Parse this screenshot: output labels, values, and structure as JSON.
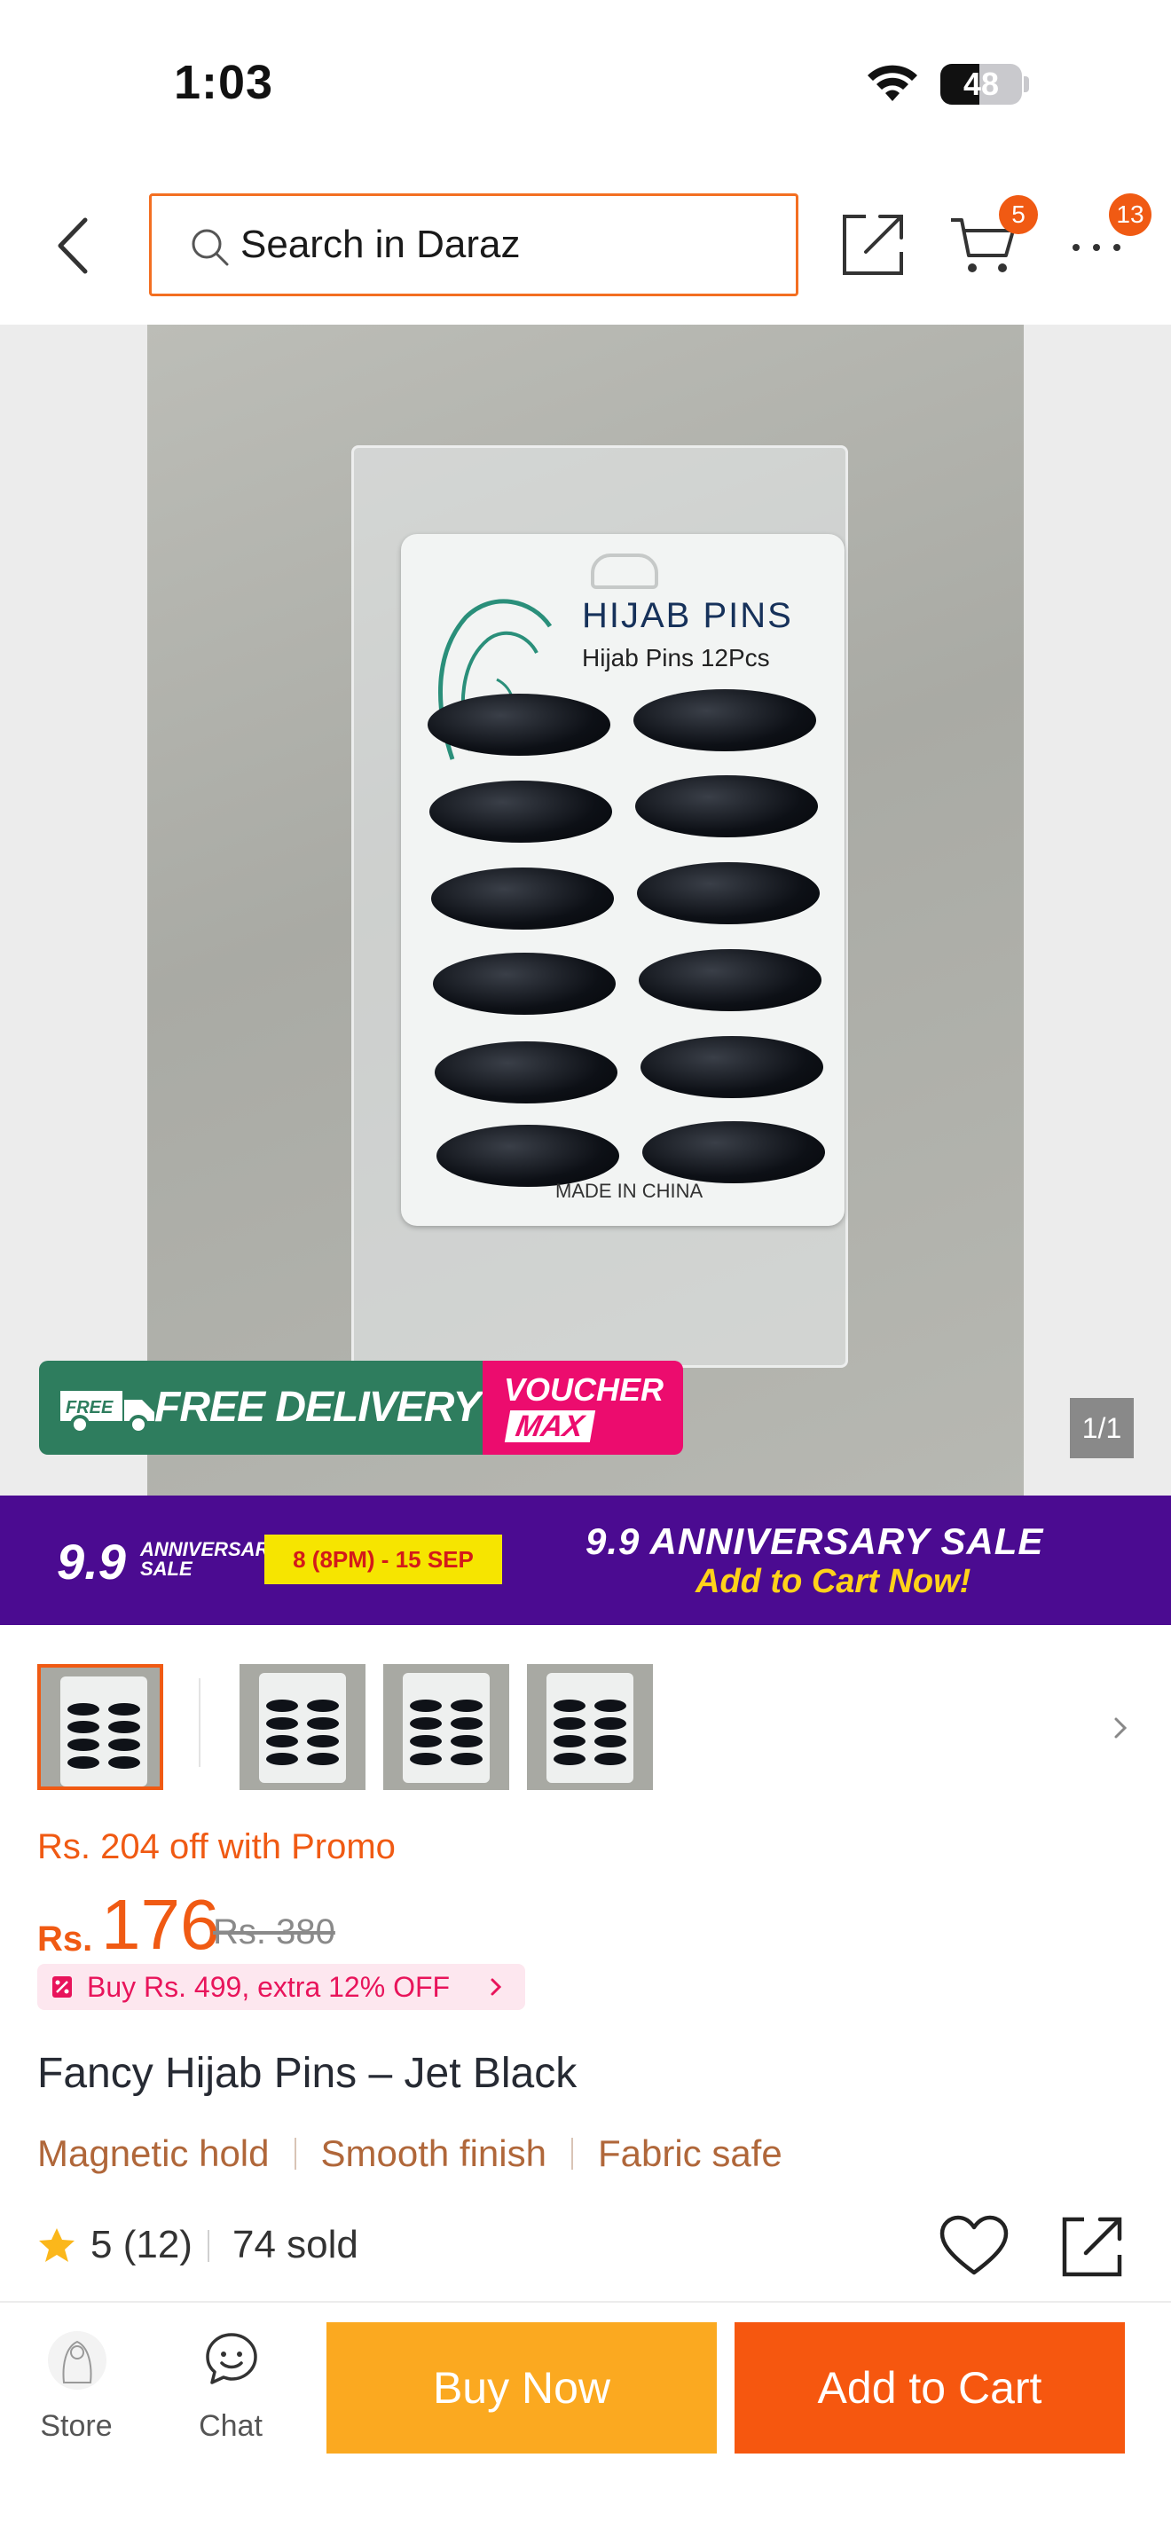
{
  "status_bar": {
    "time": "1:03",
    "battery": "48",
    "battery_level": 0.48
  },
  "nav": {
    "search_placeholder": "Search in Daraz",
    "cart_badge": "5",
    "more_badge": "13"
  },
  "gallery": {
    "packaging_title": "HIJAB PINS",
    "packaging_subtitle": "Hijab Pins 12Pcs",
    "packaging_footer": "MADE IN CHINA",
    "free_delivery_label": "FREE DELIVERY",
    "free_delivery_truck_text": "FREE",
    "voucher_label": "VOUCHER",
    "voucher_max": "MAX",
    "page_counter": "1/1"
  },
  "sale_banner": {
    "logo_number": "9.9",
    "logo_text": "ANNIVERSARY SALE",
    "dates": "8 (8PM) - 15 SEP",
    "title": "9.9 ANNIVERSARY SALE",
    "cta": "Add to Cart Now!"
  },
  "pricing": {
    "promo_text": "Rs. 204 off with Promo",
    "currency": "Rs.",
    "price": "176",
    "original_price": "Rs. 380",
    "bundle_offer": "Buy Rs. 499, extra 12% OFF"
  },
  "product": {
    "title": "Fancy Hijab Pins – Jet Black",
    "features": [
      "Magnetic hold",
      "Smooth finish",
      "Fabric safe"
    ],
    "rating": "5 (12)",
    "sold": "74 sold"
  },
  "bottom_bar": {
    "store_label": "Store",
    "chat_label": "Chat",
    "buy_now_label": "Buy Now",
    "add_to_cart_label": "Add to Cart"
  },
  "colors": {
    "brand_orange": "#f05a13",
    "buy_now": "#fba920",
    "add_to_cart": "#f6570f",
    "sale_purple": "#4b0b91"
  }
}
